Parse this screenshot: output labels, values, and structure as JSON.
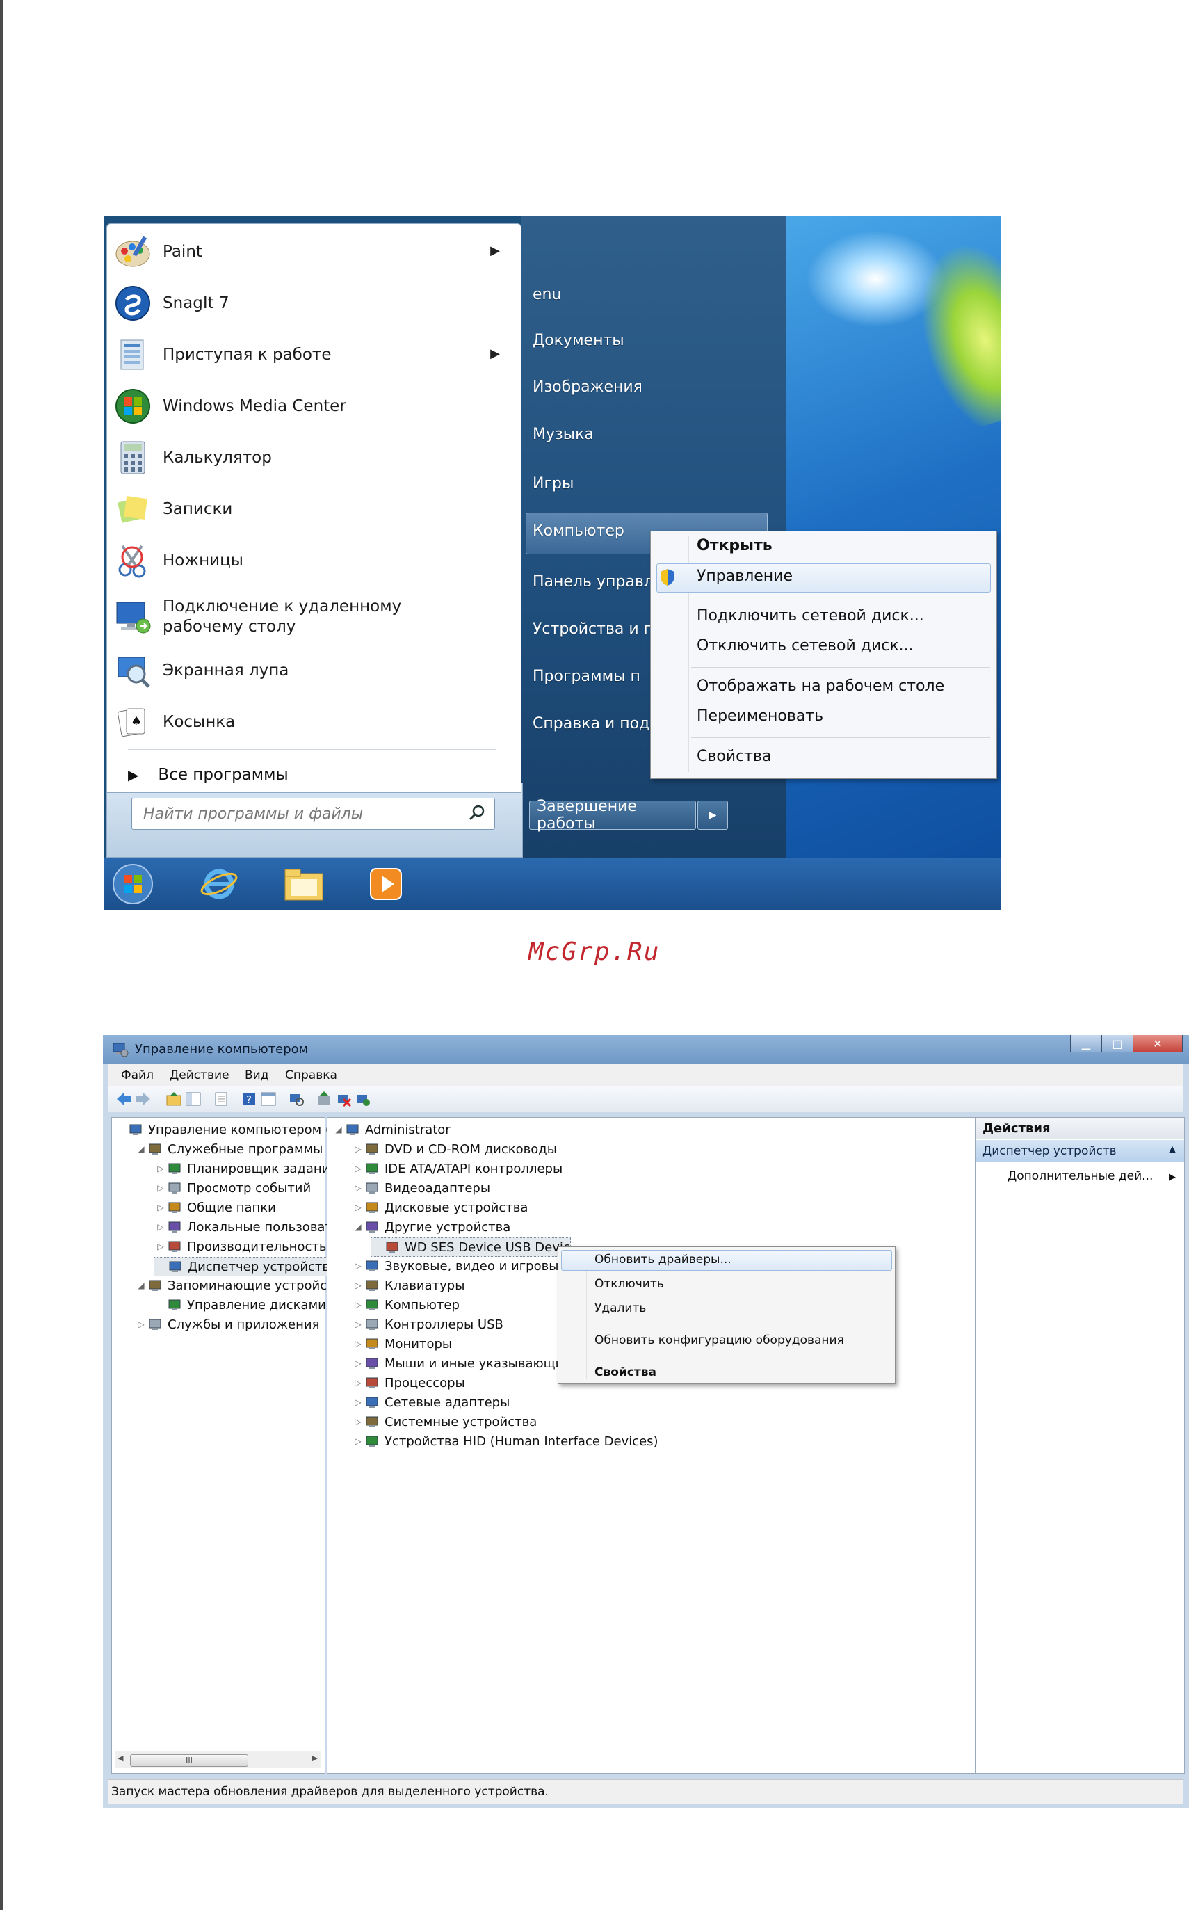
{
  "watermark": "McGrp.Ru",
  "start_menu": {
    "programs": [
      {
        "label": "Paint",
        "icon": "paint-icon",
        "has_submenu": true
      },
      {
        "label": "SnagIt 7",
        "icon": "snagit-icon",
        "has_submenu": false
      },
      {
        "label": "Приступая к работе",
        "icon": "getting-started-icon",
        "has_submenu": true
      },
      {
        "label": "Windows Media Center",
        "icon": "media-center-icon",
        "has_submenu": false
      },
      {
        "label": "Калькулятор",
        "icon": "calculator-icon",
        "has_submenu": false
      },
      {
        "label": "Записки",
        "icon": "sticky-notes-icon",
        "has_submenu": false
      },
      {
        "label": "Ножницы",
        "icon": "scissors-icon",
        "has_submenu": false
      },
      {
        "label": "Подключение к удаленному рабочему столу",
        "icon": "remote-desktop-icon",
        "has_submenu": false
      },
      {
        "label": "Экранная лупа",
        "icon": "magnifier-icon",
        "has_submenu": false
      },
      {
        "label": "Косынка",
        "icon": "solitaire-icon",
        "has_submenu": false
      }
    ],
    "all_programs": "Все программы",
    "search_placeholder": "Найти программы и файлы",
    "right_items": [
      "enu",
      "Документы",
      "Изображения",
      "Музыка",
      "Игры",
      "Компьютер",
      "Панель управл",
      "Устройства и п",
      "Программы п",
      "Справка и под"
    ],
    "shutdown_label": "Завершение работы",
    "context_menu": {
      "items": [
        "Открыть",
        "Управление",
        "Подключить сетевой диск...",
        "Отключить сетевой диск...",
        "Отображать на рабочем столе",
        "Переименовать",
        "Свойства"
      ],
      "highlighted": "Управление"
    },
    "taskbar_icons": [
      "start-orb-icon",
      "internet-explorer-icon",
      "explorer-folder-icon",
      "media-player-icon"
    ]
  },
  "mgmt": {
    "title": "Управление компьютером",
    "menu": [
      "Файл",
      "Действие",
      "Вид",
      "Справка"
    ],
    "tree": [
      {
        "label": "Управление компьютером (л",
        "level": 0,
        "expander": ""
      },
      {
        "label": "Служебные программы",
        "level": 1,
        "expander": "◢"
      },
      {
        "label": "Планировщик заданий",
        "level": 2,
        "expander": "▷"
      },
      {
        "label": "Просмотр событий",
        "level": 2,
        "expander": "▷"
      },
      {
        "label": "Общие папки",
        "level": 2,
        "expander": "▷"
      },
      {
        "label": "Локальные пользовате",
        "level": 2,
        "expander": "▷"
      },
      {
        "label": "Производительность",
        "level": 2,
        "expander": "▷"
      },
      {
        "label": "Диспетчер устройств",
        "level": 2,
        "expander": ""
      },
      {
        "label": "Запоминающие устройст",
        "level": 1,
        "expander": "◢"
      },
      {
        "label": "Управление дисками",
        "level": 2,
        "expander": ""
      },
      {
        "label": "Службы и приложения",
        "level": 1,
        "expander": "▷"
      }
    ],
    "devices": [
      {
        "label": "Administrator",
        "level": 0,
        "expander": "◢"
      },
      {
        "label": "DVD и CD-ROM дисководы",
        "level": 1,
        "expander": "▷"
      },
      {
        "label": "IDE ATA/ATAPI контроллеры",
        "level": 1,
        "expander": "▷"
      },
      {
        "label": "Видеоадаптеры",
        "level": 1,
        "expander": "▷"
      },
      {
        "label": "Дисковые устройства",
        "level": 1,
        "expander": "▷"
      },
      {
        "label": "Другие устройства",
        "level": 1,
        "expander": "◢"
      },
      {
        "label": "WD SES Device USB Devic",
        "level": 2,
        "expander": ""
      },
      {
        "label": "Звуковые, видео и игровые",
        "level": 1,
        "expander": "▷"
      },
      {
        "label": "Клавиатуры",
        "level": 1,
        "expander": "▷"
      },
      {
        "label": "Компьютер",
        "level": 1,
        "expander": "▷"
      },
      {
        "label": "Контроллеры USB",
        "level": 1,
        "expander": "▷"
      },
      {
        "label": "Мониторы",
        "level": 1,
        "expander": "▷"
      },
      {
        "label": "Мыши и иные указывающи",
        "level": 1,
        "expander": "▷"
      },
      {
        "label": "Процессоры",
        "level": 1,
        "expander": "▷"
      },
      {
        "label": "Сетевые адаптеры",
        "level": 1,
        "expander": "▷"
      },
      {
        "label": "Системные устройства",
        "level": 1,
        "expander": "▷"
      },
      {
        "label": "Устройства HID (Human Interface Devices)",
        "level": 1,
        "expander": "▷"
      }
    ],
    "context_menu": {
      "items": [
        "Обновить драйверы...",
        "Отключить",
        "Удалить",
        "Обновить конфигурацию оборудования",
        "Свойства"
      ],
      "highlighted": "Обновить драйверы..."
    },
    "actions": {
      "header": "Действия",
      "section": "Диспетчер устройств",
      "more": "Дополнительные дей..."
    },
    "scroll_thumb": "III",
    "status": "Запуск мастера обновления драйверов для выделенного устройства."
  },
  "colors": {
    "start_right_pane": "#1f4e7c",
    "taskbar": "#2b6ab0",
    "watermark": "#c1272d",
    "highlight": "#dde9f7"
  }
}
